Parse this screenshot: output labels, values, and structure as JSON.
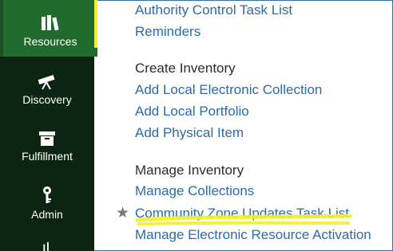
{
  "sidebar": {
    "items": [
      {
        "label": "Resources",
        "icon": "books-icon",
        "active": true
      },
      {
        "label": "Discovery",
        "icon": "telescope-icon"
      },
      {
        "label": "Fulfillment",
        "icon": "archive-box-icon"
      },
      {
        "label": "Admin",
        "icon": "key-icon"
      },
      {
        "label": "",
        "icon": "chart-icon"
      }
    ]
  },
  "menu": {
    "top_links": [
      "Authority Control Task List",
      "Reminders"
    ],
    "create_inventory": {
      "heading": "Create Inventory",
      "links": [
        "Add Local Electronic Collection",
        "Add Local Portfolio",
        "Add Physical Item"
      ]
    },
    "manage_inventory": {
      "heading": "Manage Inventory",
      "links": [
        "Manage Collections",
        "Community Zone Updates Task List",
        "Manage Electronic Resource Activation"
      ]
    }
  },
  "colors": {
    "sidebar_bg": "#0c2513",
    "sidebar_active": "#226b2e",
    "link": "#2c6aa8",
    "highlight": "#f4ee2b"
  }
}
